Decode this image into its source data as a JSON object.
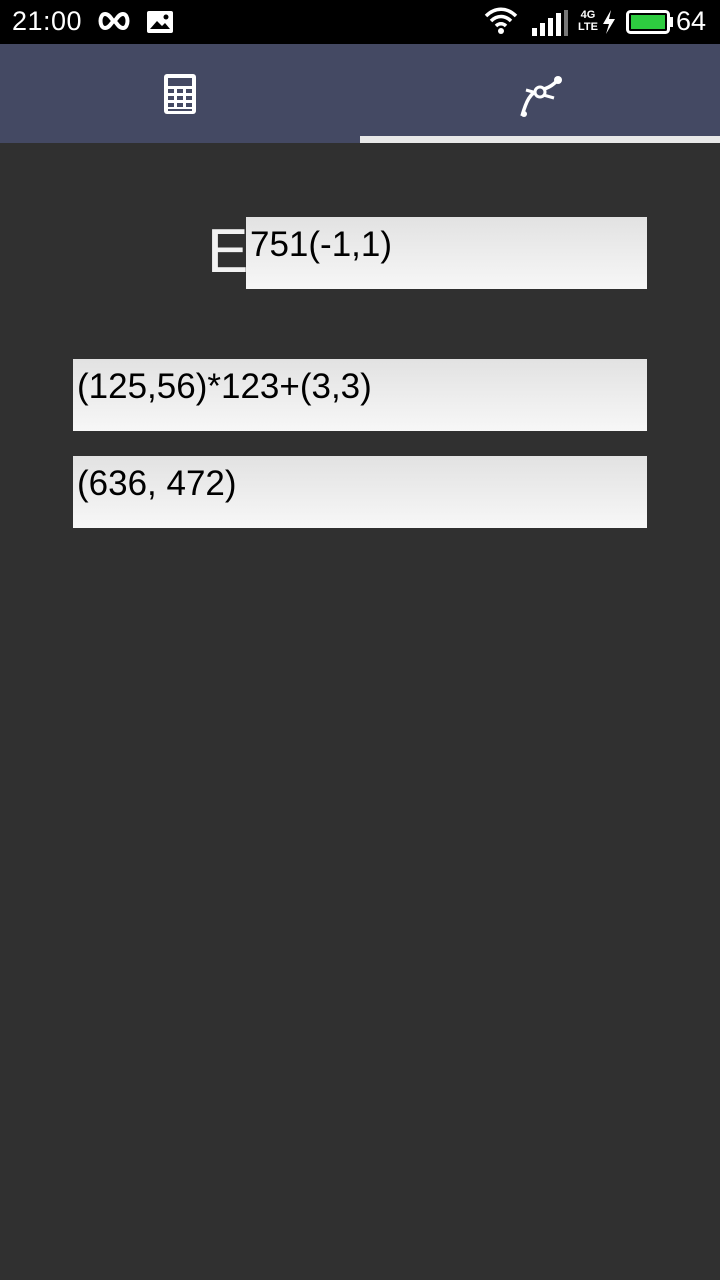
{
  "status_bar": {
    "time": "21:00",
    "network_type_top": "4G",
    "network_type_bottom": "LTE",
    "battery_level": "64",
    "icons": [
      "infinity-icon",
      "image-notification-icon",
      "wifi-icon",
      "cell-signal-icon",
      "charging-bolt-icon",
      "battery-icon"
    ]
  },
  "tabs": [
    {
      "name": "calculator",
      "icon": "calculator-icon",
      "selected": false
    },
    {
      "name": "curve",
      "icon": "curve-icon",
      "selected": true
    }
  ],
  "curve": {
    "label": "E",
    "value": "751(-1,1)"
  },
  "expression": {
    "value": "(125,56)*123+(3,3)"
  },
  "result": {
    "value": "(636, 472)"
  },
  "colors": {
    "background": "#303030",
    "tab_bar": "#444963",
    "tab_indicator": "#e8e8e8",
    "battery_fill": "#2ecc40"
  }
}
